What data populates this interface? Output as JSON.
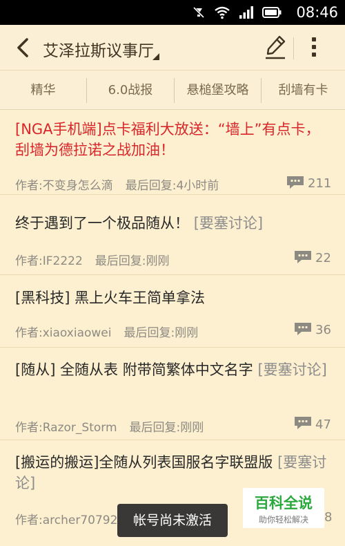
{
  "status_bar": {
    "time": "08:46",
    "icons": [
      "silent-mode-icon",
      "wifi-icon",
      "signal-icon",
      "battery-icon"
    ]
  },
  "header": {
    "title": "艾泽拉斯议事厅"
  },
  "tabs": [
    {
      "label": "精华"
    },
    {
      "label": "6.0战报"
    },
    {
      "label": "悬槌堡攻略"
    },
    {
      "label": "刮墙有卡"
    }
  ],
  "threads": [
    {
      "title": "[NGA手机端]点卡福利大放送：“墙上”有点卡，刮墙为德拉诺之战加油！",
      "tag": "",
      "author": "作者:不变身怎么滴",
      "last_reply": "最后回复:4小时前",
      "replies": "211"
    },
    {
      "title": "终于遇到了一个极品随从！",
      "tag": "[要塞讨论]",
      "author": "作者:IF2222",
      "last_reply": "最后回复:刚刚",
      "replies": "22"
    },
    {
      "title": "[黑科技] 黑上火车王简单拿法",
      "tag": "",
      "author": "作者:xiaoxiaowei",
      "last_reply": "最后回复:刚刚",
      "replies": "36"
    },
    {
      "title": "[随从] 全随从表 附带简繁体中文名字",
      "tag": "[要塞讨论]",
      "author": "作者:Razor_Storm",
      "last_reply": "最后回复:刚刚",
      "replies": "47"
    },
    {
      "title": "[搬运的搬运]全随从列表国服名字联盟版",
      "tag": "[要塞讨论]",
      "author": "作者:archer70792",
      "last_reply": "",
      "replies": "8"
    }
  ],
  "toast": "帐号尚未激活",
  "watermark": {
    "title": "百科全说",
    "subtitle": "助你轻松解决"
  },
  "colors": {
    "background": "#fdf0d0",
    "pinned_title": "#d8262a",
    "tag_gray": "#8c8c8c"
  }
}
